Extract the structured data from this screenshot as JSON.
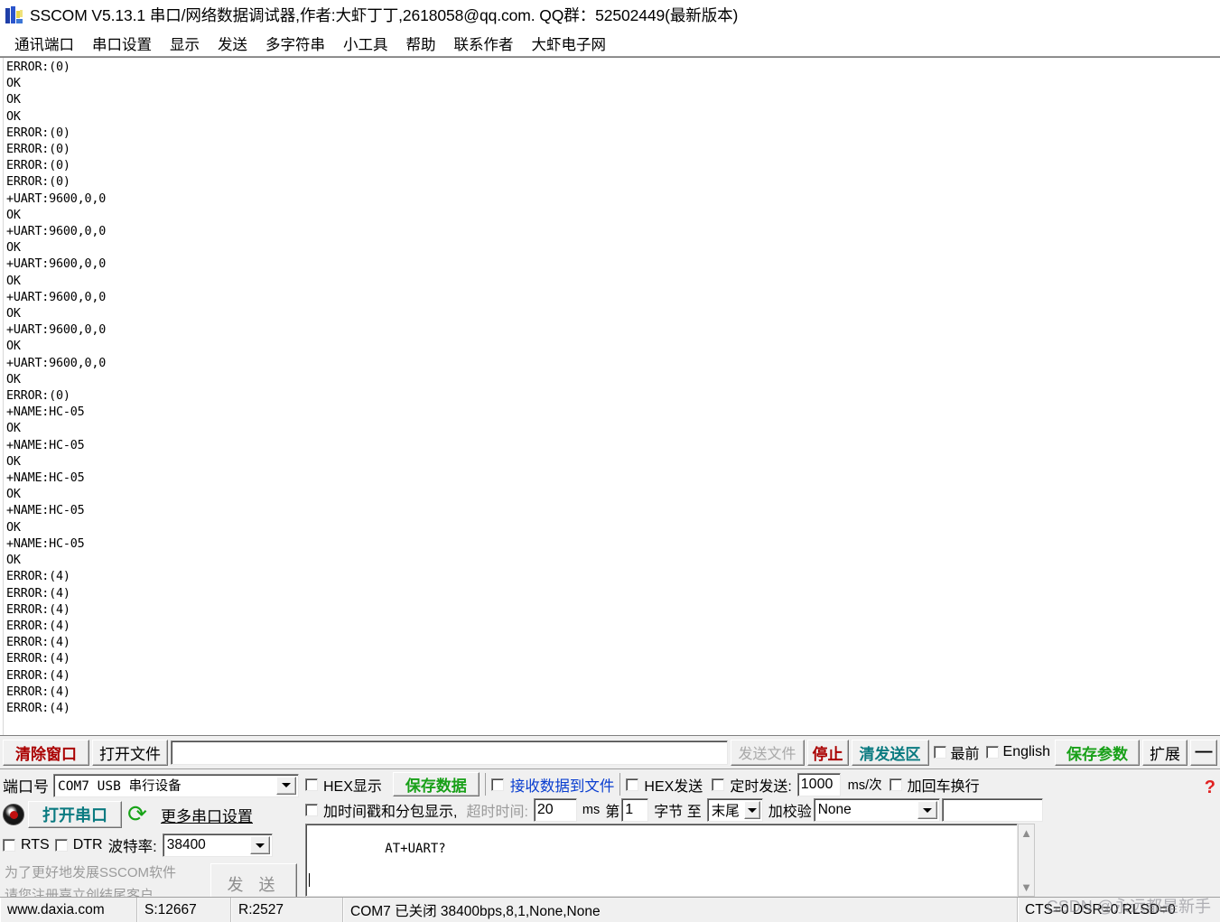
{
  "window": {
    "title": "SSCOM V5.13.1 串口/网络数据调试器,作者:大虾丁丁,2618058@qq.com. QQ群：52502449(最新版本)",
    "icon": "sscom-app-icon"
  },
  "menubar": {
    "items": [
      {
        "label": "通讯端口"
      },
      {
        "label": "串口设置"
      },
      {
        "label": "显示"
      },
      {
        "label": "发送"
      },
      {
        "label": "多字符串"
      },
      {
        "label": "小工具"
      },
      {
        "label": "帮助"
      },
      {
        "label": "联系作者"
      },
      {
        "label": "大虾电子网"
      }
    ]
  },
  "terminal": {
    "text": "ERROR:(0)\nOK\nOK\nOK\nERROR:(0)\nERROR:(0)\nERROR:(0)\nERROR:(0)\n+UART:9600,0,0\nOK\n+UART:9600,0,0\nOK\n+UART:9600,0,0\nOK\n+UART:9600,0,0\nOK\n+UART:9600,0,0\nOK\n+UART:9600,0,0\nOK\nERROR:(0)\n+NAME:HC-05\nOK\n+NAME:HC-05\nOK\n+NAME:HC-05\nOK\n+NAME:HC-05\nOK\n+NAME:HC-05\nOK\nERROR:(4)\nERROR:(4)\nERROR:(4)\nERROR:(4)\nERROR:(4)\nERROR:(4)\nERROR:(4)\nERROR:(4)\nERROR:(4)"
  },
  "toolbar": {
    "clear_window": "清除窗口",
    "open_file": "打开文件",
    "file_path_value": "",
    "send_file": "发送文件",
    "stop": "停止",
    "clear_send": "清发送区",
    "topmost_label": "最前",
    "english_label": "English",
    "save_params": "保存参数",
    "extend": "扩展",
    "minimize": "—"
  },
  "port_settings": {
    "port_label": "端口号",
    "port_value": "COM7 USB 串行设备",
    "open_port_button": "打开串口",
    "refresh_icon": "refresh-icon",
    "more_settings": "更多串口设置",
    "rts_label": "RTS",
    "dtr_label": "DTR",
    "baud_label": "波特率:",
    "baud_value": "38400",
    "promo_line1": "为了更好地发展SSCOM软件",
    "promo_line2": "请您注册嘉立创结尾客户",
    "send_button": "发 送"
  },
  "recv_settings": {
    "hex_display": "HEX显示",
    "save_data": "保存数据",
    "recv_to_file": "接收数据到文件",
    "timestamp_display": "加时间戳和分包显示,",
    "timeout_label": "超时时间:",
    "timeout_value": "20",
    "timeout_unit": "ms"
  },
  "send_settings": {
    "hex_send": "HEX发送",
    "timed_send": "定时发送:",
    "timed_value": "1000",
    "timed_unit": "ms/次",
    "add_crlf": "加回车换行",
    "byte_from_label": "第",
    "byte_from_value": "1",
    "byte_mid_label": "字节 至",
    "byte_to_value": "末尾",
    "checksum_label": "加校验",
    "checksum_value": "None",
    "extra_value": "",
    "help_icon": "help-question-icon"
  },
  "send_area": {
    "text": "AT+UART?",
    "scroll_up_icon": "chevron-up-icon",
    "scroll_down_icon": "chevron-down-icon"
  },
  "statusbar": {
    "website": "www.daxia.com",
    "sent": "S:12667",
    "received": "R:2527",
    "connection": "COM7 已关闭  38400bps,8,1,None,None",
    "signals": "CTS=0 DSR=0 RLSD=0",
    "watermark": "CSDN @永远都是新手"
  },
  "colors": {
    "accent_red": "#aa0000",
    "accent_green": "#18a018",
    "accent_teal": "#0a7a80",
    "accent_blue": "#0b3fd0",
    "window_bg": "#f0f0f0"
  }
}
